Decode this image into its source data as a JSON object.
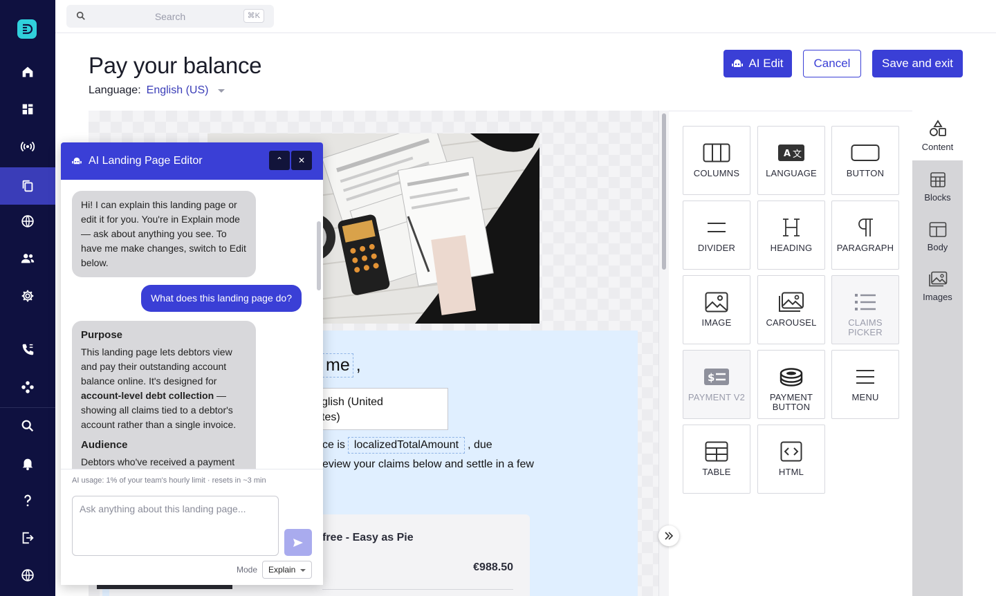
{
  "nav": {
    "items": [
      {
        "name": "home-icon"
      },
      {
        "name": "dashboard-icon"
      },
      {
        "name": "broadcast-icon"
      },
      {
        "name": "pages-icon",
        "active": true
      },
      {
        "name": "globe-icon"
      },
      {
        "name": "users-icon"
      },
      {
        "name": "settings-icon"
      },
      {
        "name": "phone-icon"
      },
      {
        "name": "integrations-icon"
      },
      {
        "name": "search-icon"
      },
      {
        "name": "bell-icon"
      },
      {
        "name": "help-icon"
      },
      {
        "name": "logout-icon"
      },
      {
        "name": "language-icon"
      }
    ]
  },
  "search": {
    "placeholder": "Search",
    "shortcut": "⌘K"
  },
  "page": {
    "title": "Pay your balance",
    "language_label": "Language:",
    "language_value": "English (US)"
  },
  "actions": {
    "ai_edit": "AI Edit",
    "cancel": "Cancel",
    "save_exit": "Save and exit"
  },
  "preview": {
    "greeting_fragment": "me",
    "greeting_comma": ",",
    "language_box_line1": "glish (United",
    "language_box_line2": "tes)",
    "due_prefix": "ce is",
    "due_token": "localizedTotalAmount",
    "due_suffix": ", due",
    "review_text": "eview your claims below and settle in a few",
    "card_name": "free - Easy as Pie",
    "card_amount": "€988.50"
  },
  "chat": {
    "title": "AI Landing Page Editor",
    "intro": "Hi! I can explain this landing page or edit it for you. You're in Explain mode — ask about anything you see. To have me make changes, switch to Edit below.",
    "user_question": "What does this landing page do?",
    "purpose_heading": "Purpose",
    "purpose_text_1": "This landing page lets debtors view and pay their outstanding account balance online. It's designed for",
    "purpose_bold": "account-level debt collection",
    "purpose_text_2": "— showing all claims tied to a debtor's account rather than a single invoice.",
    "audience_heading": "Audience",
    "audience_text": "Debtors who've received a payment",
    "usage": "AI usage: 1% of your team's hourly limit · resets in ~3 min",
    "input_placeholder": "Ask anything about this landing page...",
    "mode_label": "Mode",
    "mode_value": "Explain"
  },
  "blocks": [
    {
      "label": "COLUMNS",
      "icon": "columns-icon"
    },
    {
      "label": "LANGUAGE",
      "icon": "language-icon"
    },
    {
      "label": "BUTTON",
      "icon": "button-icon"
    },
    {
      "label": "DIVIDER",
      "icon": "divider-icon"
    },
    {
      "label": "HEADING",
      "icon": "heading-icon"
    },
    {
      "label": "PARAGRAPH",
      "icon": "paragraph-icon"
    },
    {
      "label": "IMAGE",
      "icon": "image-icon"
    },
    {
      "label": "CAROUSEL",
      "icon": "carousel-icon"
    },
    {
      "label": "CLAIMS\nPICKER",
      "icon": "claims-picker-icon",
      "disabled": true
    },
    {
      "label": "PAYMENT V2",
      "icon": "payment-icon",
      "disabled": true
    },
    {
      "label": "PAYMENT\nBUTTON",
      "icon": "payment-button-icon"
    },
    {
      "label": "MENU",
      "icon": "menu-icon"
    },
    {
      "label": "TABLE",
      "icon": "table-icon"
    },
    {
      "label": "HTML",
      "icon": "html-icon"
    }
  ],
  "side_tabs": [
    {
      "label": "Content",
      "icon": "shapes-icon",
      "active": true
    },
    {
      "label": "Blocks",
      "icon": "blocks-icon"
    },
    {
      "label": "Body",
      "icon": "body-icon"
    },
    {
      "label": "Images",
      "icon": "images-icon"
    }
  ],
  "colors": {
    "nav_bg": "#0f1140",
    "accent": "#3a3fd6",
    "logo": "#30d0dc"
  }
}
